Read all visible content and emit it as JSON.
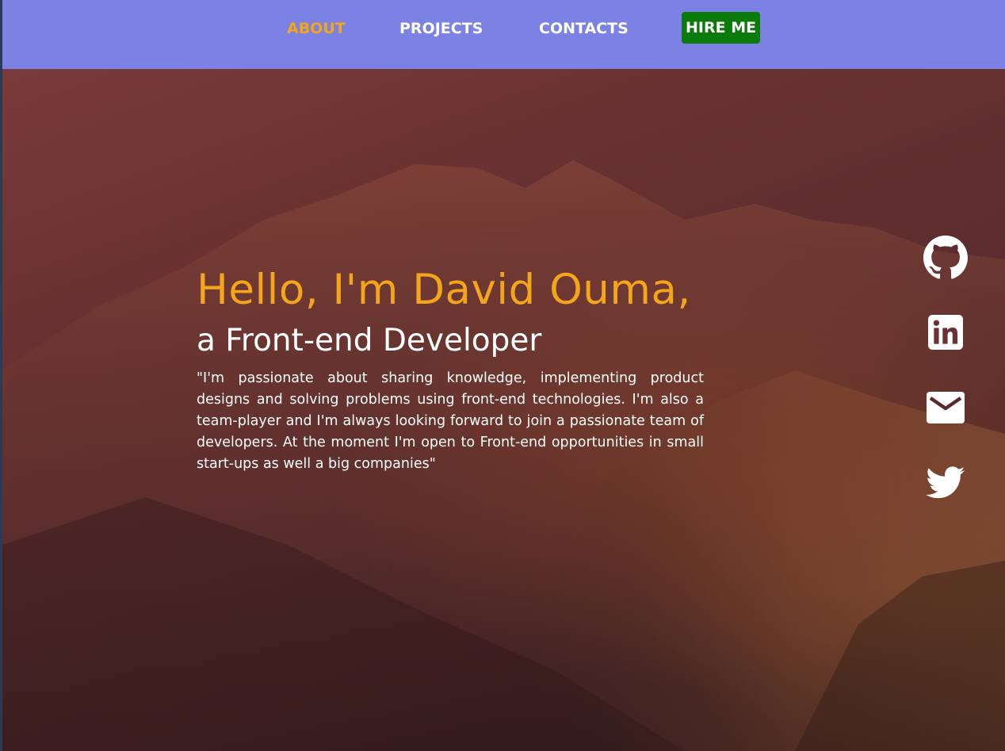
{
  "nav": {
    "items": [
      {
        "label": "ABOUT",
        "active": true
      },
      {
        "label": "PROJECTS",
        "active": false
      },
      {
        "label": "CONTACTS",
        "active": false
      }
    ],
    "cta_label": "HIRE ME"
  },
  "hero": {
    "headline": "Hello, I'm David Ouma,",
    "subheadline": "a Front-end Developer",
    "bio": "\"I'm passionate about sharing knowledge, implementing product designs and solving problems using front-end technologies. I'm also a team-player and I'm always looking forward to join a passionate team of developers. At the moment I'm open to Front-end opportunities in small start-ups as well a big companies\""
  },
  "social": [
    {
      "icon": "github-icon"
    },
    {
      "icon": "linkedin-icon"
    },
    {
      "icon": "email-icon"
    },
    {
      "icon": "twitter-icon"
    }
  ],
  "colors": {
    "navbar": "#7b82e3",
    "accent": "#f3a51b",
    "cta": "#0a7a0a",
    "text": "#ffffff"
  }
}
